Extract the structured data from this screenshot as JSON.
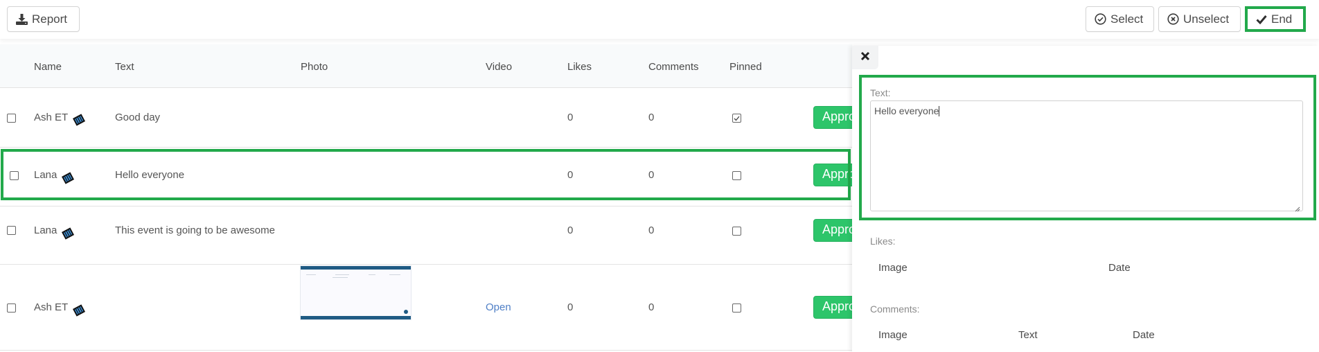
{
  "toolbar": {
    "report_label": "Report",
    "select_label": "Select",
    "unselect_label": "Unselect",
    "end_label": "End"
  },
  "table": {
    "headers": [
      "Name",
      "Text",
      "Photo",
      "Video",
      "Likes",
      "Comments",
      "Pinned"
    ],
    "rows": [
      {
        "name": "Ash ET",
        "text": "Good day",
        "photo": "",
        "video": "",
        "likes": "0",
        "comments": "0",
        "pinned": true,
        "action": "Approve"
      },
      {
        "name": "Lana",
        "text": "Hello everyone",
        "photo": "",
        "video": "",
        "likes": "0",
        "comments": "0",
        "pinned": false,
        "action": "Approve"
      },
      {
        "name": "Lana",
        "text": "This event is going to be awesome",
        "photo": "",
        "video": "",
        "likes": "0",
        "comments": "0",
        "pinned": false,
        "action": "Approve"
      },
      {
        "name": "Ash ET",
        "text": "",
        "photo": "screenshot-thumbnail",
        "video": "Open",
        "likes": "0",
        "comments": "0",
        "pinned": false,
        "action": "Approve"
      }
    ]
  },
  "panel": {
    "close_icon": "close-icon",
    "text_label": "Text:",
    "text_value": "Hello everyone",
    "likes_label": "Likes:",
    "likes_headers": [
      "Image",
      "Date"
    ],
    "comments_label": "Comments:",
    "comments_headers": [
      "Image",
      "Text",
      "Date"
    ]
  },
  "colors": {
    "highlight": "#22a94b",
    "approve": "#2dc56a",
    "link": "#4f7fc6"
  }
}
